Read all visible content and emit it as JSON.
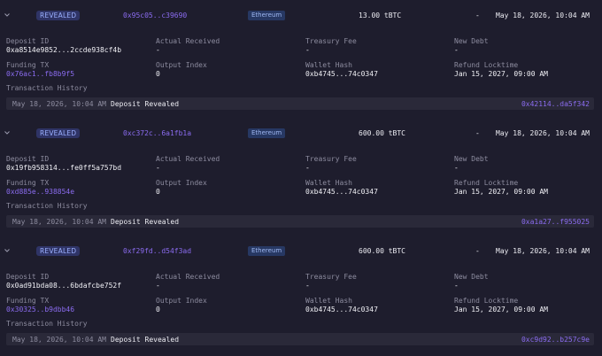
{
  "columns": {
    "deposit_id": "Deposit ID",
    "actual_received": "Actual Received",
    "treasury_fee": "Treasury Fee",
    "new_debt": "New Debt",
    "funding_tx": "Funding TX",
    "output_index": "Output Index",
    "wallet_hash": "Wallet Hash",
    "refund_locktime": "Refund Locktime",
    "transaction_history": "Transaction History"
  },
  "deposits": [
    {
      "status": "REVEALED",
      "hash": "0x95c05..c39690",
      "chain": "Ethereum",
      "amount": "13.00 tBTC",
      "dash": "-",
      "date": "May 18, 2026, 10:04 AM",
      "deposit_id": "0xa8514e9852...2ccde938cf4b",
      "actual_received": "-",
      "treasury_fee": "-",
      "new_debt": "-",
      "funding_tx": "0x76ac1..fb8b9f5",
      "output_index": "0",
      "wallet_hash": "0xb4745...74c0347",
      "refund_locktime": "Jan 15, 2027, 09:00 AM",
      "history": {
        "date": "May 18, 2026, 10:04 AM",
        "event": "Deposit Revealed",
        "tx": "0x42114..da5f342"
      }
    },
    {
      "status": "REVEALED",
      "hash": "0xc372c..6a1fb1a",
      "chain": "Ethereum",
      "amount": "600.00 tBTC",
      "dash": "-",
      "date": "May 18, 2026, 10:04 AM",
      "deposit_id": "0x19fb958314...fe0ff5a757bd",
      "actual_received": "-",
      "treasury_fee": "-",
      "new_debt": "-",
      "funding_tx": "0xd885e..938854e",
      "output_index": "0",
      "wallet_hash": "0xb4745...74c0347",
      "refund_locktime": "Jan 15, 2027, 09:00 AM",
      "history": {
        "date": "May 18, 2026, 10:04 AM",
        "event": "Deposit Revealed",
        "tx": "0xa1a27..f955025"
      }
    },
    {
      "status": "REVEALED",
      "hash": "0xf29fd..d54f3ad",
      "chain": "Ethereum",
      "amount": "600.00 tBTC",
      "dash": "-",
      "date": "May 18, 2026, 10:04 AM",
      "deposit_id": "0x0ad91bda08...6bdafcbe752f",
      "actual_received": "-",
      "treasury_fee": "-",
      "new_debt": "-",
      "funding_tx": "0x30325..b9dbb46",
      "output_index": "0",
      "wallet_hash": "0xb4745...74c0347",
      "refund_locktime": "Jan 15, 2027, 09:00 AM",
      "history": {
        "date": "May 18, 2026, 10:04 AM",
        "event": "Deposit Revealed",
        "tx": "0xc9d92..b257c9e"
      }
    }
  ]
}
